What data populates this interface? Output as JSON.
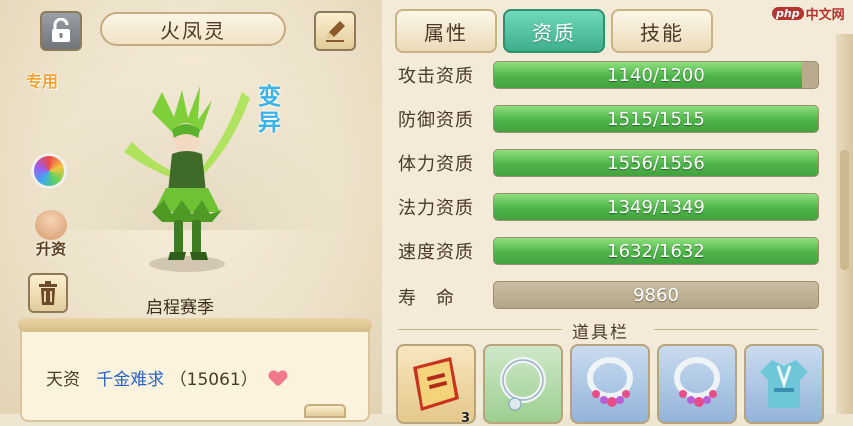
{
  "pet": {
    "name": "火凤灵",
    "exclusive_label": "专用",
    "variant_label": "变异",
    "upgrade_label": "升资",
    "season_label": "启程赛季"
  },
  "talent": {
    "label": "天资",
    "value": "千金难求",
    "score": "（15061）"
  },
  "tabs": [
    {
      "label": "属性",
      "active": false
    },
    {
      "label": "资质",
      "active": true
    },
    {
      "label": "技能",
      "active": false
    }
  ],
  "stats": [
    {
      "label": "攻击资质",
      "text": "1140/1200",
      "fill": 0.95
    },
    {
      "label": "防御资质",
      "text": "1515/1515",
      "fill": 1.0
    },
    {
      "label": "体力资质",
      "text": "1556/1556",
      "fill": 1.0
    },
    {
      "label": "法力资质",
      "text": "1349/1349",
      "fill": 1.0
    },
    {
      "label": "速度资质",
      "text": "1632/1632",
      "fill": 1.0
    }
  ],
  "lifespan": {
    "label": "寿　命",
    "value": "9860"
  },
  "tools": {
    "title": "道具栏",
    "items": [
      {
        "icon": "book-icon",
        "count": "3"
      },
      {
        "icon": "necklace-green-icon"
      },
      {
        "icon": "necklace-pink-icon"
      },
      {
        "icon": "necklace-pink-icon"
      },
      {
        "icon": "armor-icon"
      }
    ]
  },
  "watermark": {
    "logo": "php",
    "text": "中文网"
  },
  "colors": {
    "tab_active": "#3fae8c",
    "bar_fill": "#4eb44a",
    "bar_bg": "#b8ab8e",
    "variant_text": "#3ab3e6",
    "exclusive_text": "#f6a431",
    "talent_value": "#2a64c5"
  }
}
